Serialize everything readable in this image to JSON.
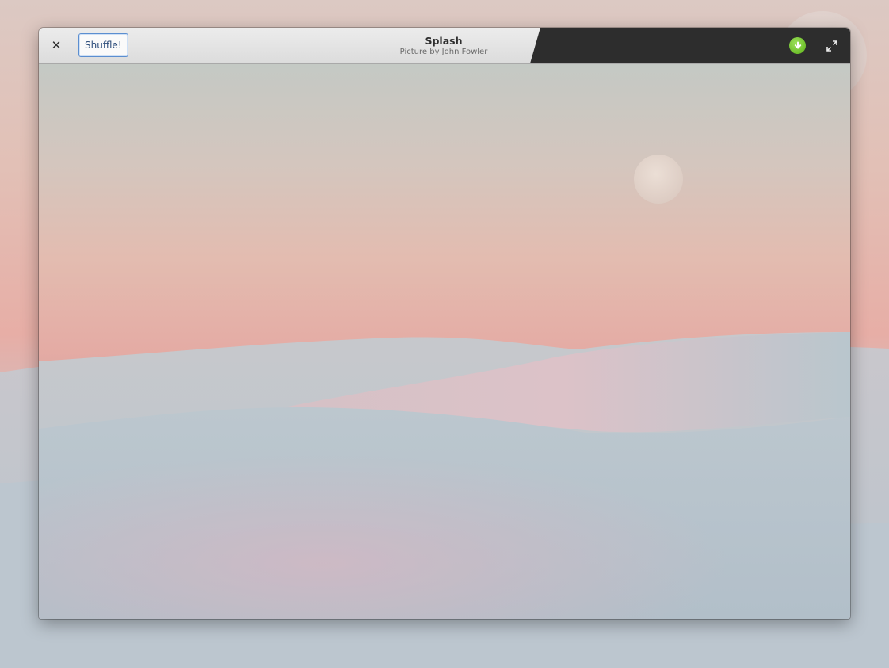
{
  "window": {
    "title": "Splash",
    "subtitle": "Picture by John Fowler"
  },
  "toolbar": {
    "close_icon": "close-icon",
    "shuffle_label": "Shuffle!",
    "download_icon": "download-icon",
    "fullscreen_icon": "fullscreen-icon"
  },
  "colors": {
    "accent_green": "#6fbf2c",
    "headerbar_dark": "#2d2d2d",
    "button_focus_border": "#5b8ed0"
  }
}
